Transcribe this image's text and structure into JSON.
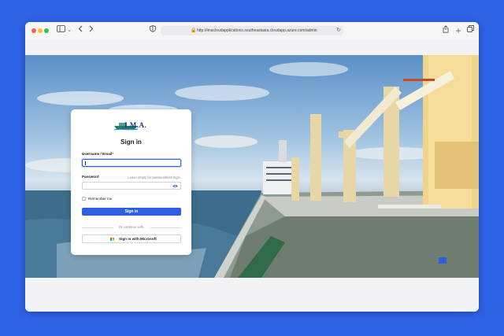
{
  "browser": {
    "url": "http://imacloudapplications.southeastasia.cloudapp.azure.com/admin"
  },
  "login": {
    "logo_text": "I.M.A.",
    "title": "Sign in",
    "username_label": "Username / Email",
    "username_required_mark": "*",
    "username_value": "",
    "password_label": "Password",
    "password_hint": "Leave empty for passwordless login.",
    "password_value": "",
    "remember_label": "Remember me",
    "remember_checked": false,
    "signin_label": "Sign in",
    "divider_text": "Or continue with",
    "microsoft_label": "Sign in with Microsoft"
  },
  "icons": {
    "sidebar": "sidebar-icon",
    "back": "chevron-left-icon",
    "forward": "chevron-right-icon",
    "shield": "shield-icon",
    "lock": "lock-icon",
    "reload": "reload-icon",
    "share": "share-icon",
    "new_tab": "plus-icon",
    "tabs": "tabs-icon",
    "eye": "eye-icon",
    "microsoft": "microsoft-logo-icon"
  },
  "colors": {
    "desktop": "#2f63e6",
    "primary": "#2d5fe0",
    "logo": "#20357a",
    "ms_red": "#f25022",
    "ms_green": "#7fba00",
    "ms_blue": "#00a4ef",
    "ms_yellow": "#ffb900"
  }
}
